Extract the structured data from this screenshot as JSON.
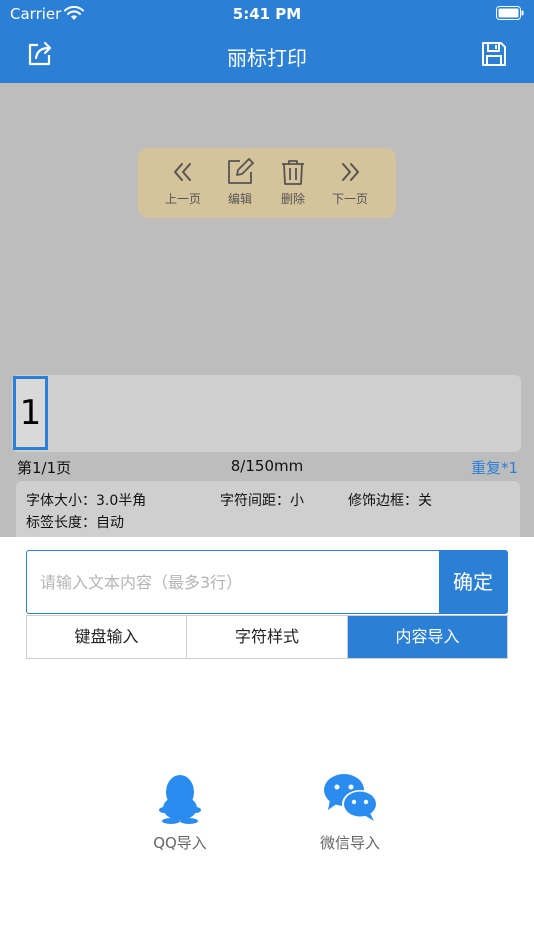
{
  "status": {
    "carrier": "Carrier",
    "time": "5:41 PM"
  },
  "nav": {
    "title": "丽标打印",
    "share_icon": "share-icon",
    "save_icon": "save-icon"
  },
  "toolbar": {
    "prev": "上一页",
    "edit": "编辑",
    "delete": "删除",
    "next": "下一页"
  },
  "label": {
    "char": "1"
  },
  "page_info": {
    "index": "第1/1页",
    "length": "8/150mm",
    "repeat": "重复*1"
  },
  "settings": {
    "font_size": "字体大小：3.0半角",
    "char_spacing": "字符间距：小",
    "frame": "修饰边框：关",
    "label_length": "标签长度：自动"
  },
  "input": {
    "placeholder": "请输入文本内容（最多3行）",
    "value": "",
    "confirm": "确定"
  },
  "tabs": [
    {
      "label": "键盘输入",
      "active": false
    },
    {
      "label": "字符样式",
      "active": false
    },
    {
      "label": "内容导入",
      "active": true
    }
  ],
  "imports": {
    "qq": "QQ导入",
    "wechat": "微信导入"
  },
  "colors": {
    "primary": "#2b7fd4",
    "canvas": "#bdbdbd",
    "toolbox": "#d4c39b"
  }
}
